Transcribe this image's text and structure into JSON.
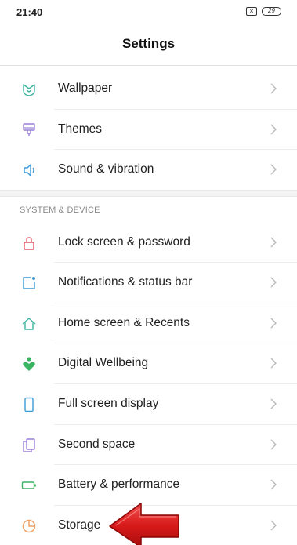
{
  "status_bar": {
    "time": "21:40",
    "sim_icon": "sim-x-icon",
    "sim_glyph": "×",
    "battery_level": "29"
  },
  "header": {
    "title": "Settings"
  },
  "groups": [
    {
      "items": [
        {
          "label": "Wallpaper",
          "icon": "wallpaper-icon",
          "icon_color": "#3bb49e"
        },
        {
          "label": "Themes",
          "icon": "themes-brush-icon",
          "icon_color": "#9b7fd8"
        },
        {
          "label": "Sound & vibration",
          "icon": "speaker-icon",
          "icon_color": "#3a9bd8"
        }
      ]
    },
    {
      "section_title": "SYSTEM & DEVICE",
      "items": [
        {
          "label": "Lock screen & password",
          "icon": "lock-icon",
          "icon_color": "#e0596b"
        },
        {
          "label": "Notifications & status bar",
          "icon": "notification-icon",
          "icon_color": "#3a9bd8"
        },
        {
          "label": "Home screen & Recents",
          "icon": "home-icon",
          "icon_color": "#3bb49e"
        },
        {
          "label": "Digital Wellbeing",
          "icon": "wellbeing-icon",
          "icon_color": "#3bb464"
        },
        {
          "label": "Full screen display",
          "icon": "phone-icon",
          "icon_color": "#3a9bd8"
        },
        {
          "label": "Second space",
          "icon": "second-space-icon",
          "icon_color": "#9b7fd8"
        },
        {
          "label": "Battery & performance",
          "icon": "battery-icon",
          "icon_color": "#3bb464"
        },
        {
          "label": "Storage",
          "icon": "storage-pie-icon",
          "icon_color": "#f0a060"
        }
      ]
    }
  ],
  "annotation": {
    "icon": "red-arrow-icon",
    "color": "#e02020"
  }
}
